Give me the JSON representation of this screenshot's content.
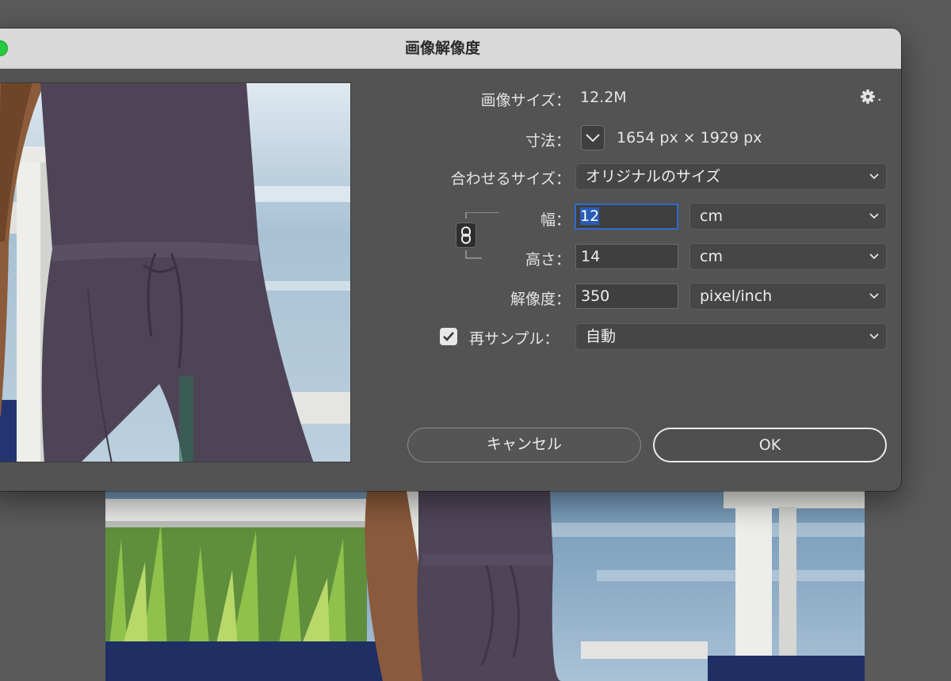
{
  "dialog": {
    "title": "画像解像度"
  },
  "image_size": {
    "label": "画像サイズ：",
    "value": "12.2M"
  },
  "dimensions": {
    "label": "寸法：",
    "value": "1654 px × 1929 px"
  },
  "fit_to": {
    "label": "合わせるサイズ：",
    "selected": "オリジナルのサイズ"
  },
  "width": {
    "label": "幅：",
    "value": "12",
    "unit": "cm"
  },
  "height": {
    "label": "高さ：",
    "value": "14",
    "unit": "cm"
  },
  "resolution": {
    "label": "解像度：",
    "value": "350",
    "unit": "pixel/inch"
  },
  "resample": {
    "label": "再サンプル：",
    "checked": true,
    "selected": "自動"
  },
  "buttons": {
    "cancel": "キャンセル",
    "ok": "OK"
  },
  "icons": {
    "settings": "gear-icon",
    "dimension_dropdown": "chevron-down-icon",
    "constrain": "chain-link-icon",
    "checkbox": "checkmark-icon"
  },
  "colors": {
    "dialog_bg": "#535353",
    "titlebar_bg": "#d9d9d9",
    "focus_ring": "#2f6bd0",
    "traffic_green": "#27c93f"
  }
}
